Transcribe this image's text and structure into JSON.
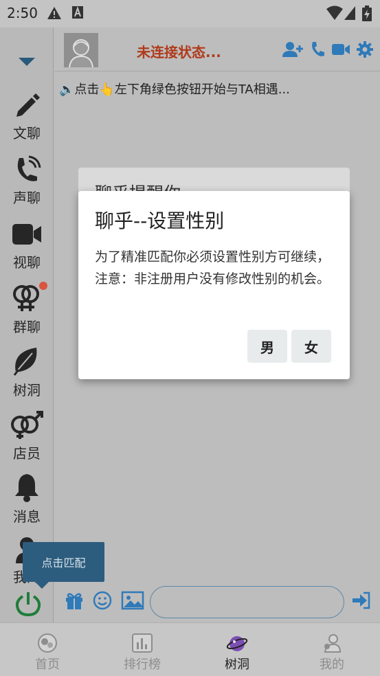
{
  "status_bar": {
    "time": "2:50"
  },
  "sidebar": {
    "items": [
      {
        "label": "文聊"
      },
      {
        "label": "声聊"
      },
      {
        "label": "视聊"
      },
      {
        "label": "群聊"
      },
      {
        "label": "树洞"
      },
      {
        "label": "店员"
      },
      {
        "label": "消息"
      },
      {
        "label": "我的"
      }
    ]
  },
  "header": {
    "connection_status": "未连接状态..."
  },
  "notice": {
    "text": "🔈点击👆左下角绿色按钮开始与TA相遇..."
  },
  "tooltip": {
    "label": "点击匹配"
  },
  "tabs": [
    {
      "label": "首页"
    },
    {
      "label": "排行榜"
    },
    {
      "label": "树洞"
    },
    {
      "label": "我的"
    }
  ],
  "dialog_behind": {
    "title": "聊乎提醒你"
  },
  "dialog": {
    "title": "聊乎--设置性别",
    "message": "为了精准匹配你必须设置性别方可继续，注意：非注册用户没有修改性别的机会。",
    "male_label": "男",
    "female_label": "女"
  },
  "colors": {
    "accent_blue": "#2f7ab9",
    "status_red": "#b03a1a",
    "power_green": "#1f7d3a",
    "badge_red": "#d9553f"
  }
}
